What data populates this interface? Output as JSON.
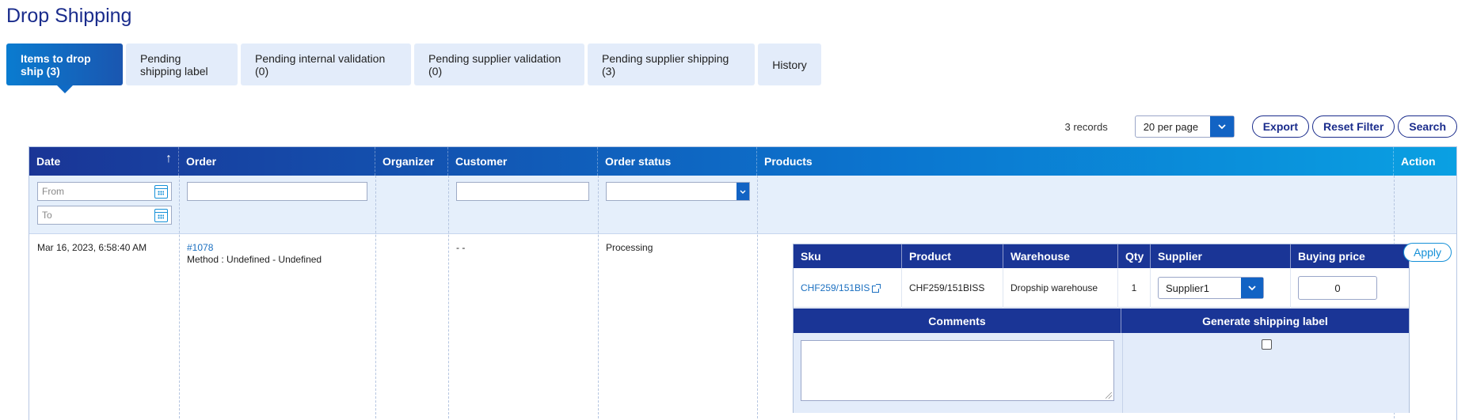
{
  "page": {
    "title": "Drop Shipping"
  },
  "tabs": [
    {
      "label": "Items to drop ship (3)",
      "active": true
    },
    {
      "label": "Pending shipping label",
      "active": false
    },
    {
      "label": "Pending internal validation (0)",
      "active": false
    },
    {
      "label": "Pending supplier validation (0)",
      "active": false
    },
    {
      "label": "Pending supplier shipping (3)",
      "active": false
    },
    {
      "label": "History",
      "active": false
    }
  ],
  "toolbar": {
    "records": "3 records",
    "per_page": "20 per page",
    "export_label": "Export",
    "reset_label": "Reset Filter",
    "search_label": "Search"
  },
  "grid": {
    "columns": {
      "date": "Date",
      "order": "Order",
      "organizer": "Organizer",
      "customer": "Customer",
      "order_status": "Order status",
      "products": "Products",
      "action": "Action"
    },
    "filters": {
      "date_from_placeholder": "From",
      "date_to_placeholder": "To",
      "order_value": "",
      "customer_value": "",
      "status_value": ""
    },
    "rows": [
      {
        "date": "Mar 16, 2023, 6:58:40 AM",
        "order_number": "#1078",
        "order_method": "Method : Undefined - Undefined",
        "organizer": "",
        "customer": "- -",
        "order_status": "Processing",
        "action_label": "Apply",
        "products": {
          "headers": {
            "sku": "Sku",
            "product": "Product",
            "warehouse": "Warehouse",
            "qty": "Qty",
            "supplier": "Supplier",
            "buying_price": "Buying price"
          },
          "items": [
            {
              "sku": "CHF259/151BIS",
              "product": "CHF259/151BISS",
              "warehouse": "Dropship warehouse",
              "qty": "1",
              "supplier": "Supplier1",
              "buying_price": "0"
            }
          ],
          "comments_label": "Comments",
          "generate_label": "Generate shipping label",
          "comment_value": "",
          "generate_checked": false
        }
      }
    ]
  },
  "colors": {
    "title": "#1a2c8c",
    "header_dark": "#1a3596",
    "header_light": "#0aa0e2",
    "tab_bg": "#e3ecfa",
    "link": "#1a6fc0"
  }
}
